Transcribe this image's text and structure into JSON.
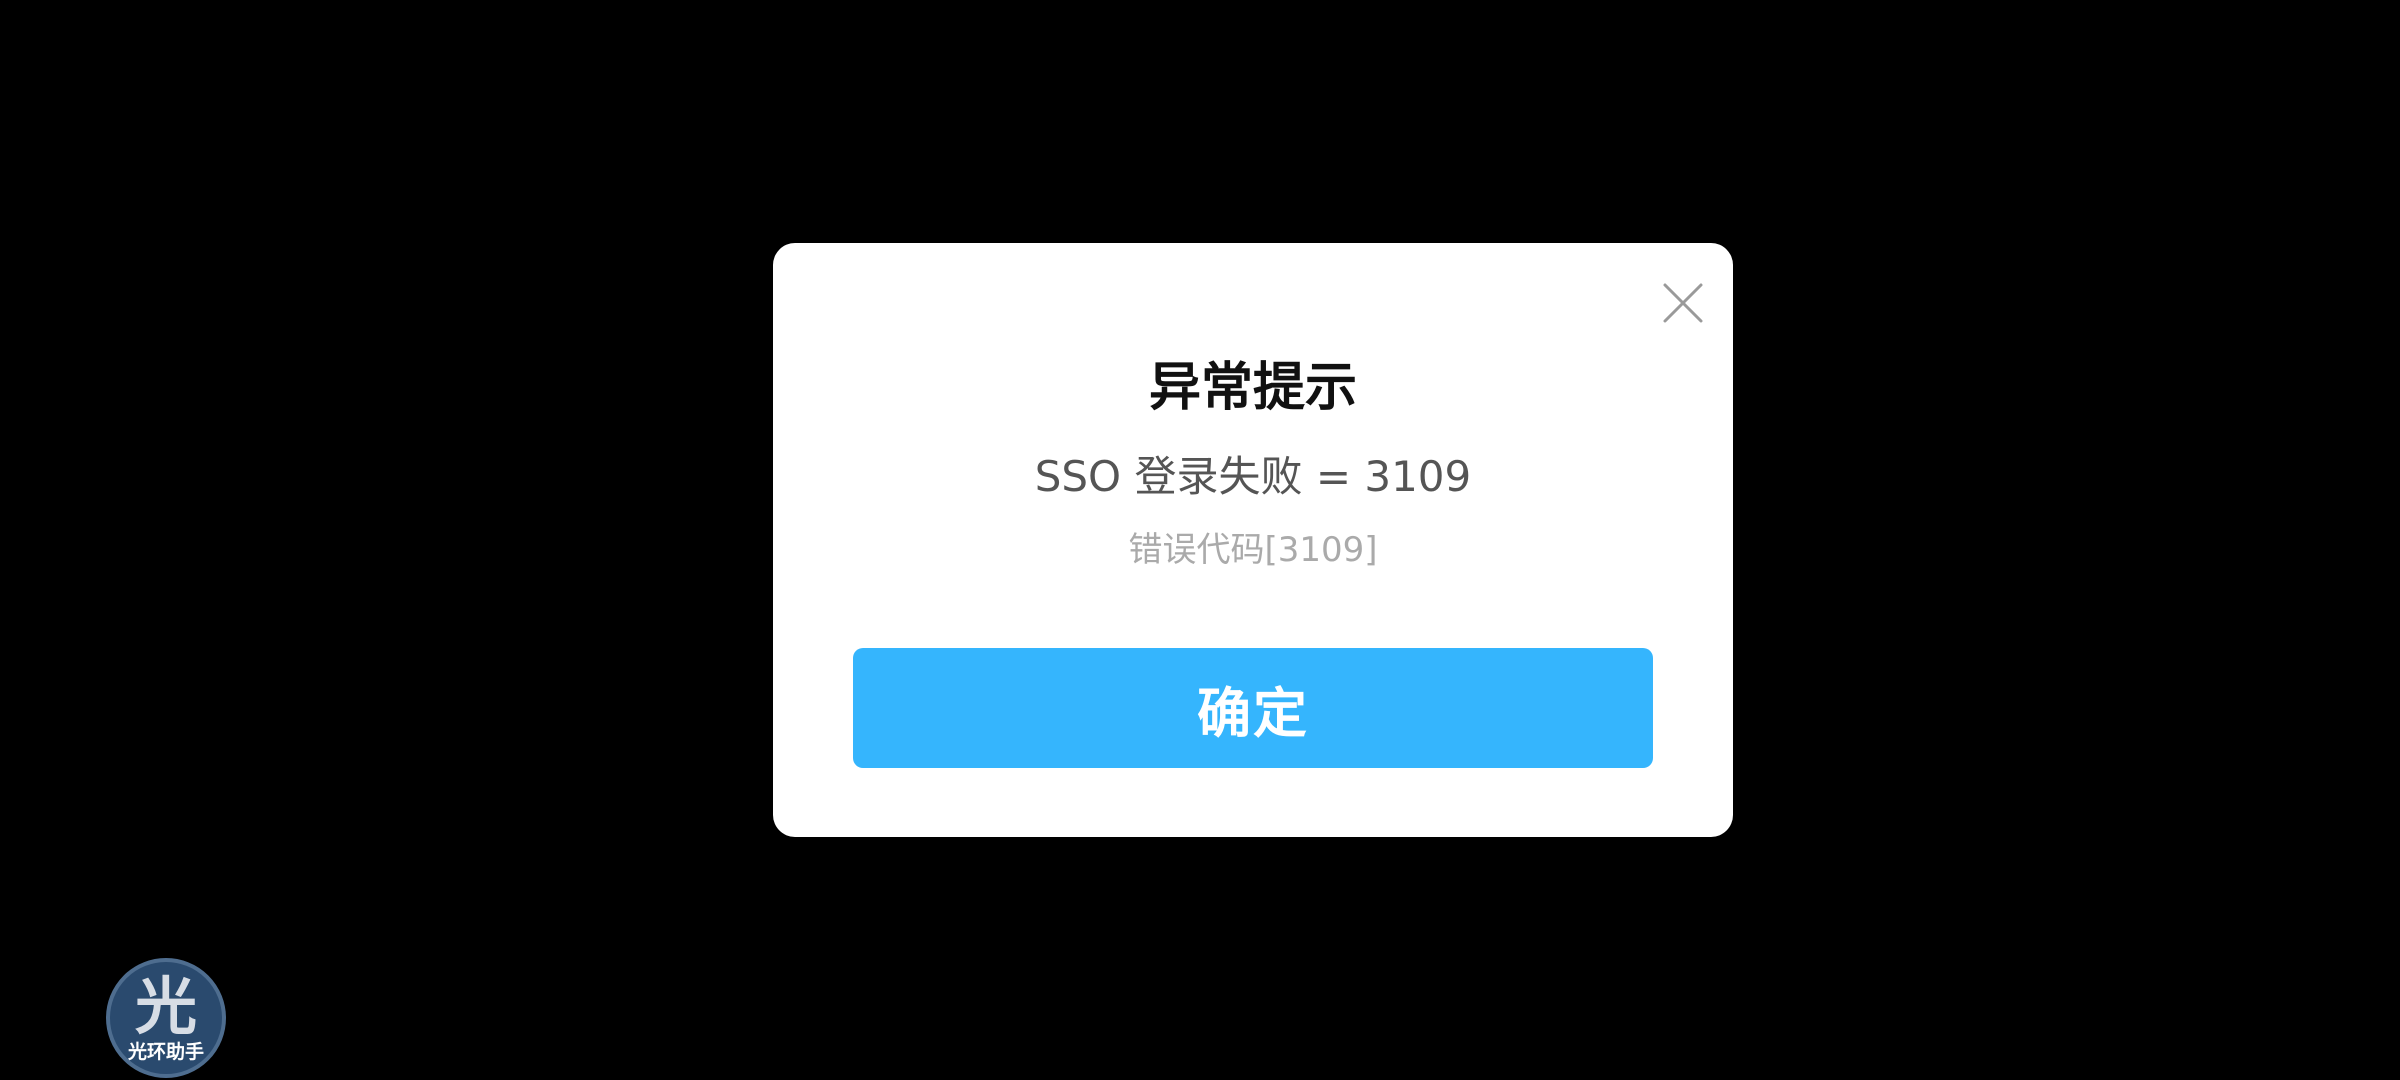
{
  "dialog": {
    "title": "异常提示",
    "message": "SSO 登录失败 = 3109",
    "error_code": "错误代码[3109]",
    "confirm_label": "确定",
    "close_icon": "close-icon"
  },
  "floating_assistant": {
    "glyph": "光",
    "label": "光环助手"
  },
  "colors": {
    "background": "#000000",
    "dialog_background": "#ffffff",
    "title": "#111111",
    "message": "#555555",
    "error_code": "#aaaaaa",
    "confirm_button": "#35b5fd",
    "badge_background": "#2a4a6e"
  }
}
